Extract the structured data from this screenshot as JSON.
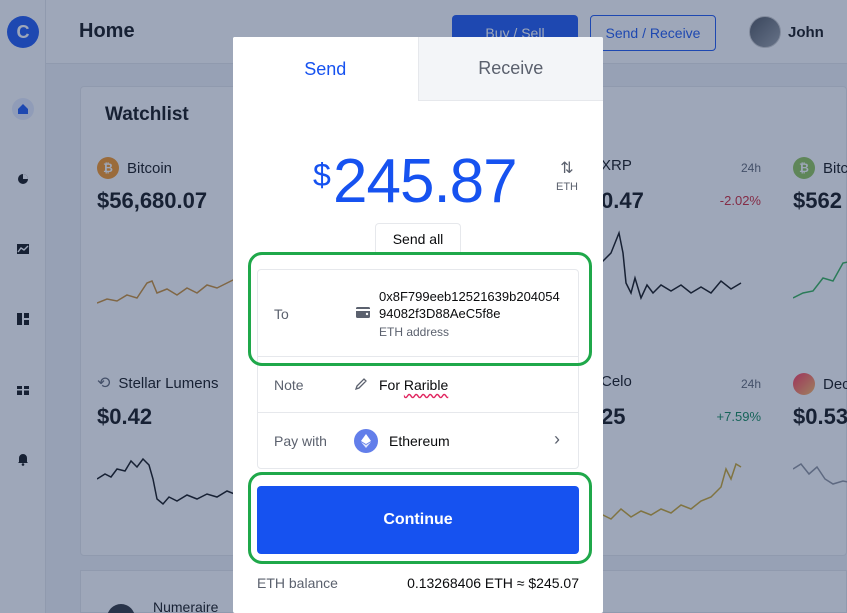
{
  "header": {
    "title": "Home",
    "buy_sell_label": "Buy / Sell",
    "send_receive_label": "Send / Receive",
    "user_name": "John"
  },
  "sidebar": {
    "logo": "C",
    "items": [
      {
        "icon": "home-icon"
      },
      {
        "icon": "portfolio-icon"
      },
      {
        "icon": "trade-icon"
      },
      {
        "icon": "dashboard-icon"
      },
      {
        "icon": "gift-icon"
      },
      {
        "icon": "bell-icon"
      }
    ]
  },
  "watchlist": {
    "title": "Watchlist",
    "cards": [
      {
        "name": "Bitcoin",
        "price": "$56,680.07",
        "color": "#f7931a",
        "symbol": "₿"
      },
      {
        "name": "XRP",
        "price": "0.47",
        "period": "24h",
        "change": "-2.02%",
        "change_color": "#cf202f"
      },
      {
        "name": "Bitcoin Cash",
        "price": "$562",
        "color": "#8dc351",
        "symbol": "₿"
      },
      {
        "name": "Stellar Lumens",
        "price": "$0.42"
      },
      {
        "name": "Celo",
        "price": "25",
        "period": "24h",
        "change": "+7.59%",
        "change_color": "#098551"
      },
      {
        "name": "Decentraland",
        "price": "$0.53"
      }
    ],
    "bottom_item": "Numeraire"
  },
  "modal": {
    "tab_send": "Send",
    "tab_receive": "Receive",
    "currency_symbol": "$",
    "amount": "245.87",
    "swap_label": "ETH",
    "send_all_label": "Send all",
    "to_label": "To",
    "to_address": "0x8F799eeb12521639b20405494082f3D88AeC5f8e",
    "to_address_sub": "ETH address",
    "note_label": "Note",
    "note_prefix": "For ",
    "note_word": "Rarible",
    "pay_with_label": "Pay with",
    "pay_with_value": "Ethereum",
    "continue_label": "Continue",
    "balance_label": "ETH balance",
    "balance_value": "0.13268406 ETH  ≈ $245.07"
  },
  "colors": {
    "brand": "#1652f0",
    "highlight": "#1fa84a"
  }
}
